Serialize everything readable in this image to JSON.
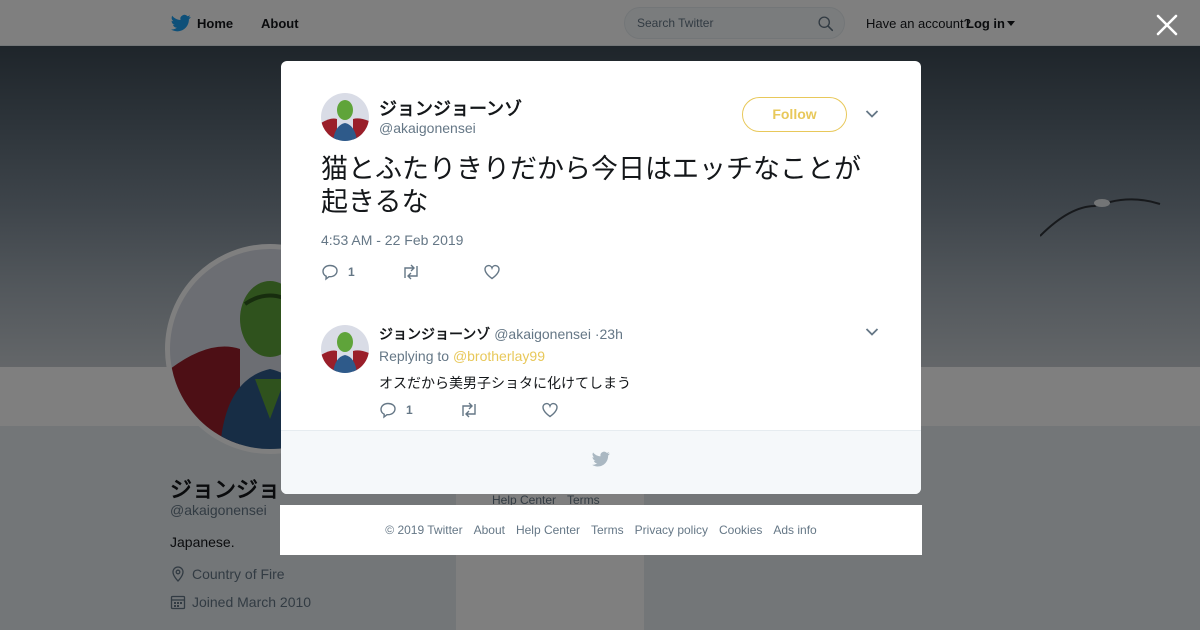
{
  "nav": {
    "home_label": "Home",
    "about_label": "About",
    "search_placeholder": "Search Twitter",
    "account_prompt": "Have an account?",
    "login_label": "Log in",
    "icons": [
      "twitter-bird-icon",
      "search-icon",
      "caret-down-icon",
      "close-icon"
    ]
  },
  "profile": {
    "name": "ジョンジョ",
    "handle": "@akaigonensei",
    "bio": "Japanese.",
    "location": "Country of Fire",
    "joined": "Joined March 2010",
    "sidebar_help": "Help Center",
    "sidebar_terms": "Terms"
  },
  "tweet": {
    "name": "ジョンジョーンゾ",
    "handle": "@akaigonensei",
    "follow_label": "Follow",
    "text": "猫とふたりきりだから今日はエッチなことが起きるな",
    "timestamp": "4:53 AM - 22 Feb 2019",
    "reply_count": "1",
    "retweet_count": "",
    "like_count": ""
  },
  "reply": {
    "name": "ジョンジョーンゾ",
    "handle": "@akaigonensei",
    "dot": "·",
    "time": "23h",
    "replying_to_prefix": "Replying to",
    "replying_to_handle": "@brotherlay99",
    "text": "オスだから美男子ショタに化けてしまう",
    "reply_count": "1"
  },
  "footer": {
    "copyright": "© 2019 Twitter",
    "links": [
      "About",
      "Help Center",
      "Terms",
      "Privacy policy",
      "Cookies",
      "Ads info"
    ]
  },
  "colors": {
    "accent": "#e8c85a",
    "twitter_blue": "#1da1f2",
    "muted": "#657786"
  }
}
